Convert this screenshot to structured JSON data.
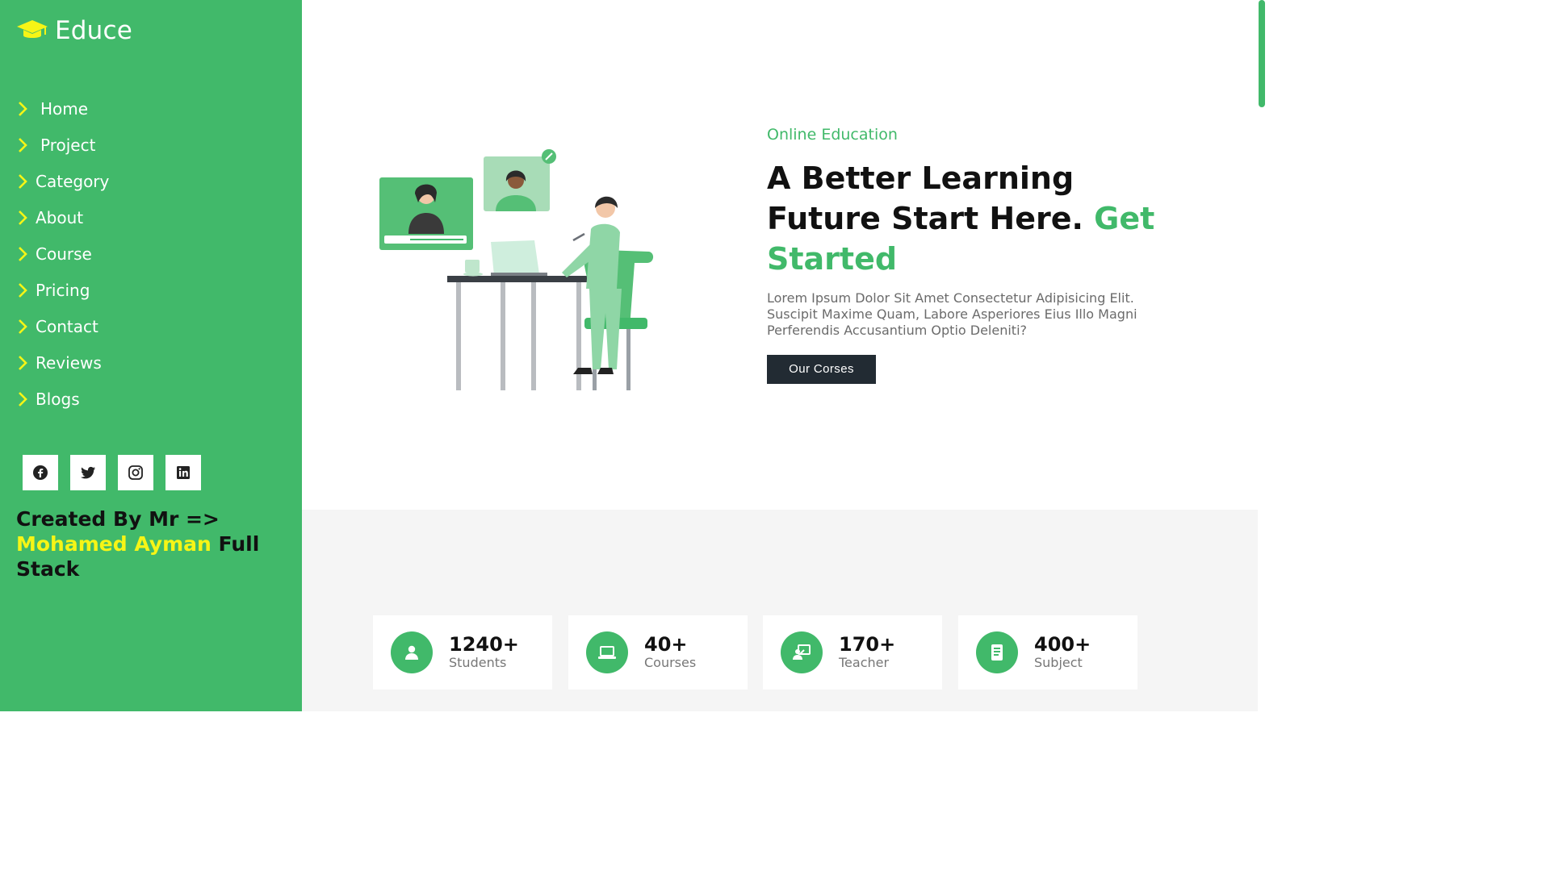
{
  "brand": {
    "name": "Educe",
    "icon": "graduation-cap-icon",
    "icon_color": "#f6f516"
  },
  "sidebar": {
    "background": "#41b96a",
    "items": [
      {
        "label": "Home",
        "icon": "chevron-right-icon"
      },
      {
        "label": "Project",
        "icon": "chevron-right-icon"
      },
      {
        "label": "Category",
        "icon": "chevron-right-icon"
      },
      {
        "label": "About",
        "icon": "chevron-right-icon"
      },
      {
        "label": "Course",
        "icon": "chevron-right-icon"
      },
      {
        "label": "Pricing",
        "icon": "chevron-right-icon"
      },
      {
        "label": "Contact",
        "icon": "chevron-right-icon"
      },
      {
        "label": "Reviews",
        "icon": "chevron-right-icon"
      },
      {
        "label": "Blogs",
        "icon": "chevron-right-icon"
      }
    ],
    "socials": [
      "facebook-icon",
      "twitter-icon",
      "instagram-icon",
      "linkedin-icon"
    ],
    "credit": {
      "prefix": "Created By Mr =>",
      "name": "Mohamed Ayman",
      "suffix": "Full Stack"
    }
  },
  "hero": {
    "kicker": "Online Education",
    "headline_part1": "A Better Learning Future Start Here.",
    "headline_accent": "Get Started",
    "description": "Lorem Ipsum Dolor Sit Amet Consectetur Adipisicing Elit. Suscipit Maxime Quam, Labore Asperiores Eius Illo Magni Perferendis Accusantium Optio Deleniti?",
    "cta_label": "Our Corses",
    "illustration": "online-learning-illustration"
  },
  "stats": [
    {
      "value": "1240+",
      "label": "Students",
      "icon": "user-icon"
    },
    {
      "value": "40+",
      "label": "Courses",
      "icon": "laptop-icon"
    },
    {
      "value": "170+",
      "label": "Teacher",
      "icon": "teacher-board-icon"
    },
    {
      "value": "400+",
      "label": "Subject",
      "icon": "book-icon"
    }
  ],
  "colors": {
    "accent": "#41b96a",
    "dark_button": "#222b33",
    "highlight": "#f6f516"
  }
}
